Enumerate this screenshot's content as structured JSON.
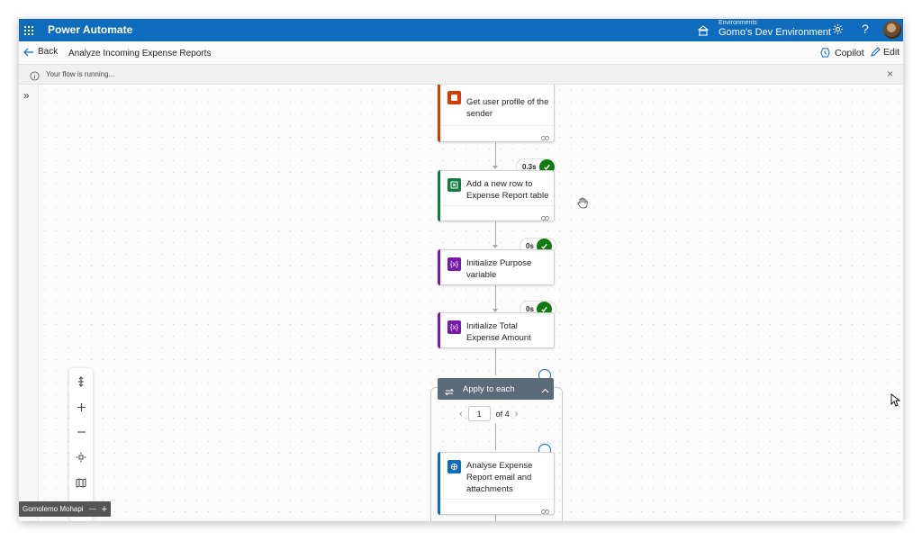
{
  "topbar": {
    "app_name": "Power Automate",
    "env_label": "Environments",
    "env_name": "Gomo's Dev Environment",
    "help": "?"
  },
  "cmdbar": {
    "back_label": "Back",
    "flow_title": "Analyze Incoming Expense Reports",
    "copilot_label": "Copilot",
    "edit_label": "Edit"
  },
  "status": {
    "text": "Your flow is running...",
    "close": "×"
  },
  "rail": {
    "expand": "»"
  },
  "presence": {
    "name": "Gomolemo Mohapi",
    "add": "+"
  },
  "flow": {
    "steps": [
      {
        "title": "Get user profile of the sender",
        "accent": "#d83b01",
        "icon": "office-icon"
      },
      {
        "title": "Add a new row to Expense Report table",
        "accent": "#107c41",
        "icon": "excel-icon",
        "duration": "0.3s"
      },
      {
        "title": "Initialize Purpose variable",
        "accent": "#7719aa",
        "icon": "variable-icon",
        "duration": "0s"
      },
      {
        "title": "Initialize Total Expense Amount",
        "accent": "#7719aa",
        "icon": "variable-icon",
        "duration": "0s"
      }
    ],
    "apply_to_each": {
      "title": "Apply to each",
      "page_current": "1",
      "page_total": "of 4"
    },
    "inner_step": {
      "title": "Analyse Expense Report email and attachments",
      "accent": "#0f6cbd",
      "icon": "ai-builder-icon"
    }
  },
  "colors": {
    "brand": "#0f6cbd",
    "success": "#107c10",
    "loop_header": "#5c6b7a"
  }
}
